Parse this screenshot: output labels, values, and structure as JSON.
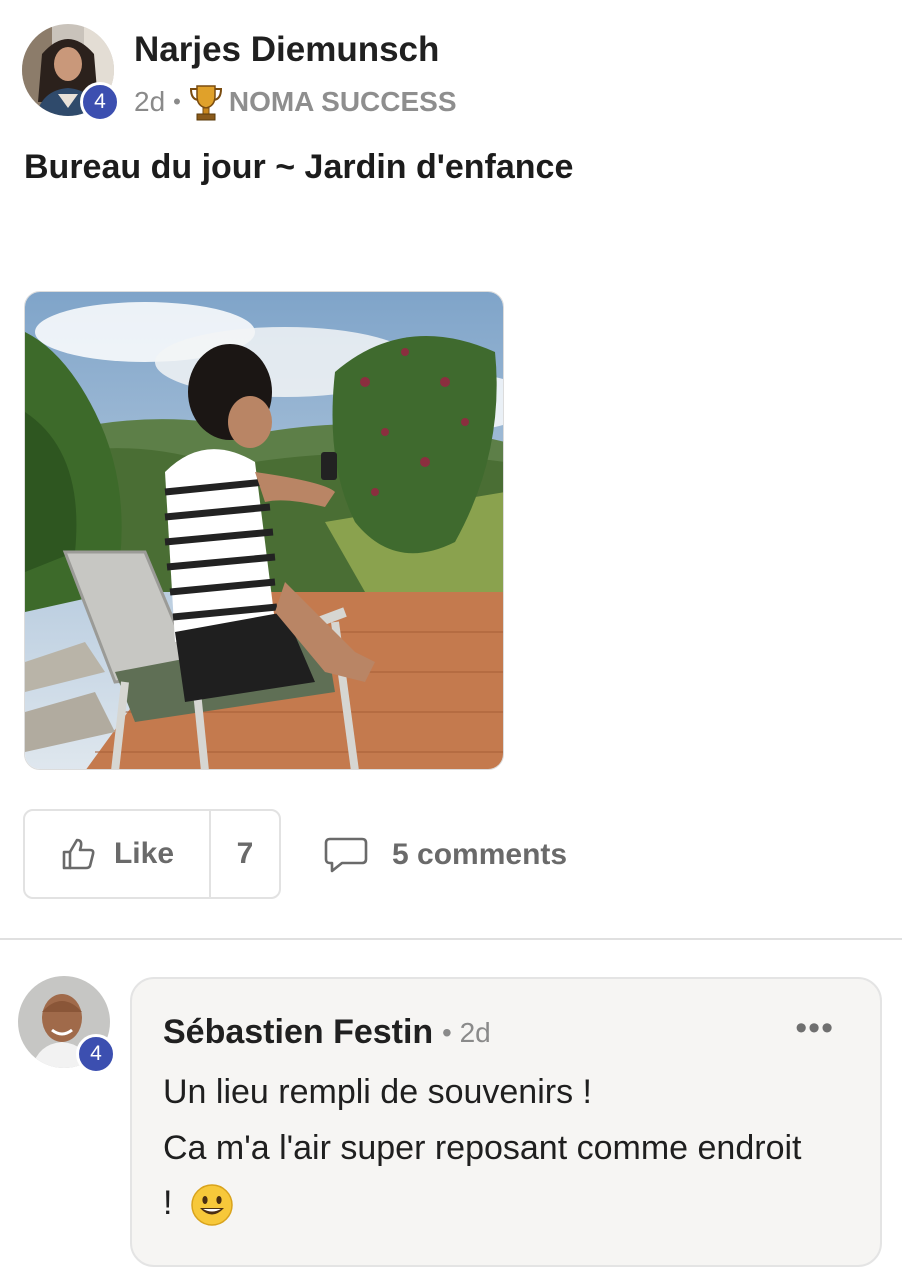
{
  "post": {
    "author": "Narjes Diemunsch",
    "author_level": "4",
    "time": "2d",
    "separator": "•",
    "category": "NOMA SUCCESS",
    "title": "Bureau du jour ~ Jardin d'enfance"
  },
  "actions": {
    "like_label": "Like",
    "like_count": "7",
    "comments_label": "5 comments"
  },
  "comment": {
    "author": "Sébastien Festin",
    "author_level": "4",
    "time": "• 2d",
    "more": "•••",
    "line1": "Un lieu rempli de souvenirs !",
    "line2": "Ca m'a l'air super reposant comme endroit",
    "line3": "!"
  },
  "colors": {
    "badge": "#3c4fb0",
    "bubble": "#f6f5f3",
    "muted_text": "#8a8a8a"
  },
  "icons": {
    "like": "thumbs-up-icon",
    "comment": "speech-bubble-icon",
    "category": "trophy-icon",
    "more": "more-options-icon"
  }
}
